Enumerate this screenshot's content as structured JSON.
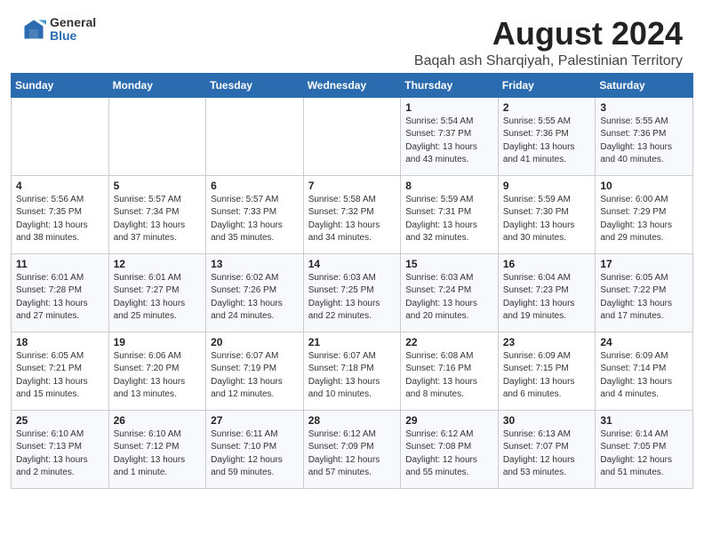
{
  "logo": {
    "general": "General",
    "blue": "Blue"
  },
  "header": {
    "month": "August 2024",
    "location": "Baqah ash Sharqiyah, Palestinian Territory"
  },
  "days_of_week": [
    "Sunday",
    "Monday",
    "Tuesday",
    "Wednesday",
    "Thursday",
    "Friday",
    "Saturday"
  ],
  "weeks": [
    [
      {
        "day": "",
        "info": ""
      },
      {
        "day": "",
        "info": ""
      },
      {
        "day": "",
        "info": ""
      },
      {
        "day": "",
        "info": ""
      },
      {
        "day": "1",
        "info": "Sunrise: 5:54 AM\nSunset: 7:37 PM\nDaylight: 13 hours\nand 43 minutes."
      },
      {
        "day": "2",
        "info": "Sunrise: 5:55 AM\nSunset: 7:36 PM\nDaylight: 13 hours\nand 41 minutes."
      },
      {
        "day": "3",
        "info": "Sunrise: 5:55 AM\nSunset: 7:36 PM\nDaylight: 13 hours\nand 40 minutes."
      }
    ],
    [
      {
        "day": "4",
        "info": "Sunrise: 5:56 AM\nSunset: 7:35 PM\nDaylight: 13 hours\nand 38 minutes."
      },
      {
        "day": "5",
        "info": "Sunrise: 5:57 AM\nSunset: 7:34 PM\nDaylight: 13 hours\nand 37 minutes."
      },
      {
        "day": "6",
        "info": "Sunrise: 5:57 AM\nSunset: 7:33 PM\nDaylight: 13 hours\nand 35 minutes."
      },
      {
        "day": "7",
        "info": "Sunrise: 5:58 AM\nSunset: 7:32 PM\nDaylight: 13 hours\nand 34 minutes."
      },
      {
        "day": "8",
        "info": "Sunrise: 5:59 AM\nSunset: 7:31 PM\nDaylight: 13 hours\nand 32 minutes."
      },
      {
        "day": "9",
        "info": "Sunrise: 5:59 AM\nSunset: 7:30 PM\nDaylight: 13 hours\nand 30 minutes."
      },
      {
        "day": "10",
        "info": "Sunrise: 6:00 AM\nSunset: 7:29 PM\nDaylight: 13 hours\nand 29 minutes."
      }
    ],
    [
      {
        "day": "11",
        "info": "Sunrise: 6:01 AM\nSunset: 7:28 PM\nDaylight: 13 hours\nand 27 minutes."
      },
      {
        "day": "12",
        "info": "Sunrise: 6:01 AM\nSunset: 7:27 PM\nDaylight: 13 hours\nand 25 minutes."
      },
      {
        "day": "13",
        "info": "Sunrise: 6:02 AM\nSunset: 7:26 PM\nDaylight: 13 hours\nand 24 minutes."
      },
      {
        "day": "14",
        "info": "Sunrise: 6:03 AM\nSunset: 7:25 PM\nDaylight: 13 hours\nand 22 minutes."
      },
      {
        "day": "15",
        "info": "Sunrise: 6:03 AM\nSunset: 7:24 PM\nDaylight: 13 hours\nand 20 minutes."
      },
      {
        "day": "16",
        "info": "Sunrise: 6:04 AM\nSunset: 7:23 PM\nDaylight: 13 hours\nand 19 minutes."
      },
      {
        "day": "17",
        "info": "Sunrise: 6:05 AM\nSunset: 7:22 PM\nDaylight: 13 hours\nand 17 minutes."
      }
    ],
    [
      {
        "day": "18",
        "info": "Sunrise: 6:05 AM\nSunset: 7:21 PM\nDaylight: 13 hours\nand 15 minutes."
      },
      {
        "day": "19",
        "info": "Sunrise: 6:06 AM\nSunset: 7:20 PM\nDaylight: 13 hours\nand 13 minutes."
      },
      {
        "day": "20",
        "info": "Sunrise: 6:07 AM\nSunset: 7:19 PM\nDaylight: 13 hours\nand 12 minutes."
      },
      {
        "day": "21",
        "info": "Sunrise: 6:07 AM\nSunset: 7:18 PM\nDaylight: 13 hours\nand 10 minutes."
      },
      {
        "day": "22",
        "info": "Sunrise: 6:08 AM\nSunset: 7:16 PM\nDaylight: 13 hours\nand 8 minutes."
      },
      {
        "day": "23",
        "info": "Sunrise: 6:09 AM\nSunset: 7:15 PM\nDaylight: 13 hours\nand 6 minutes."
      },
      {
        "day": "24",
        "info": "Sunrise: 6:09 AM\nSunset: 7:14 PM\nDaylight: 13 hours\nand 4 minutes."
      }
    ],
    [
      {
        "day": "25",
        "info": "Sunrise: 6:10 AM\nSunset: 7:13 PM\nDaylight: 13 hours\nand 2 minutes."
      },
      {
        "day": "26",
        "info": "Sunrise: 6:10 AM\nSunset: 7:12 PM\nDaylight: 13 hours\nand 1 minute."
      },
      {
        "day": "27",
        "info": "Sunrise: 6:11 AM\nSunset: 7:10 PM\nDaylight: 12 hours\nand 59 minutes."
      },
      {
        "day": "28",
        "info": "Sunrise: 6:12 AM\nSunset: 7:09 PM\nDaylight: 12 hours\nand 57 minutes."
      },
      {
        "day": "29",
        "info": "Sunrise: 6:12 AM\nSunset: 7:08 PM\nDaylight: 12 hours\nand 55 minutes."
      },
      {
        "day": "30",
        "info": "Sunrise: 6:13 AM\nSunset: 7:07 PM\nDaylight: 12 hours\nand 53 minutes."
      },
      {
        "day": "31",
        "info": "Sunrise: 6:14 AM\nSunset: 7:05 PM\nDaylight: 12 hours\nand 51 minutes."
      }
    ]
  ]
}
